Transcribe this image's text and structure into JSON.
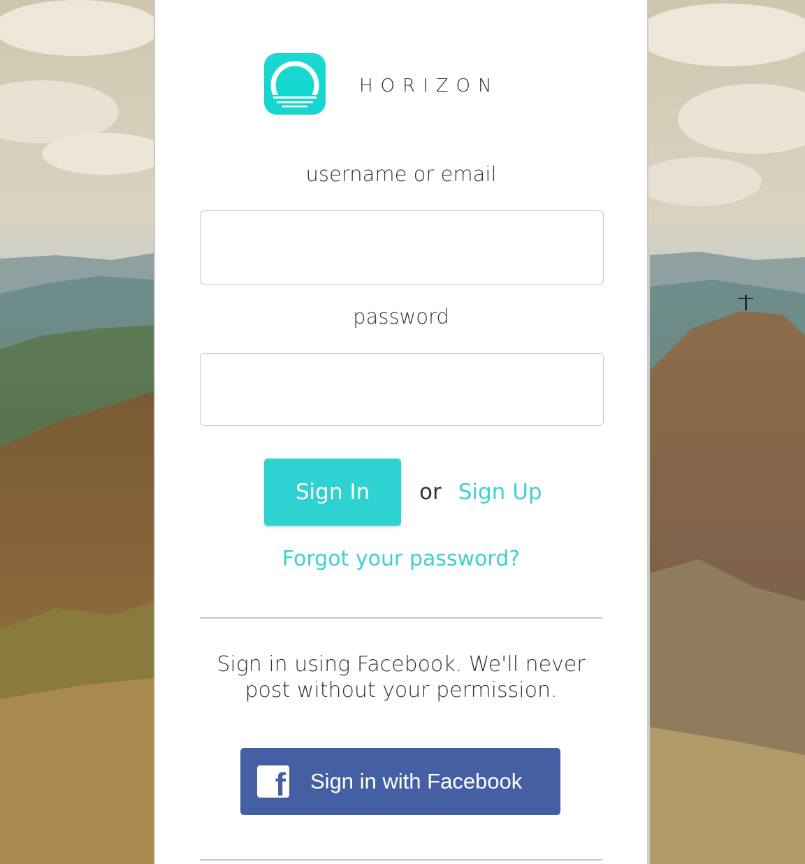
{
  "brand": {
    "name": "HORIZON",
    "accent_color": "#2ed3d1",
    "icon": "horizon-sunrise-icon"
  },
  "login": {
    "username_label": "username or email",
    "username_value": "",
    "password_label": "password",
    "password_value": "",
    "signin_label": "Sign In",
    "or_text": "or",
    "signup_label": "Sign Up",
    "forgot_label": "Forgot your password?"
  },
  "facebook": {
    "note": "Sign in using Facebook. We'll never post without your permission.",
    "button_label": "Sign in with Facebook",
    "icon": "facebook-icon",
    "icon_glyph": "f",
    "color": "#4460a3"
  },
  "background": {
    "image": "mountain-landscape"
  }
}
